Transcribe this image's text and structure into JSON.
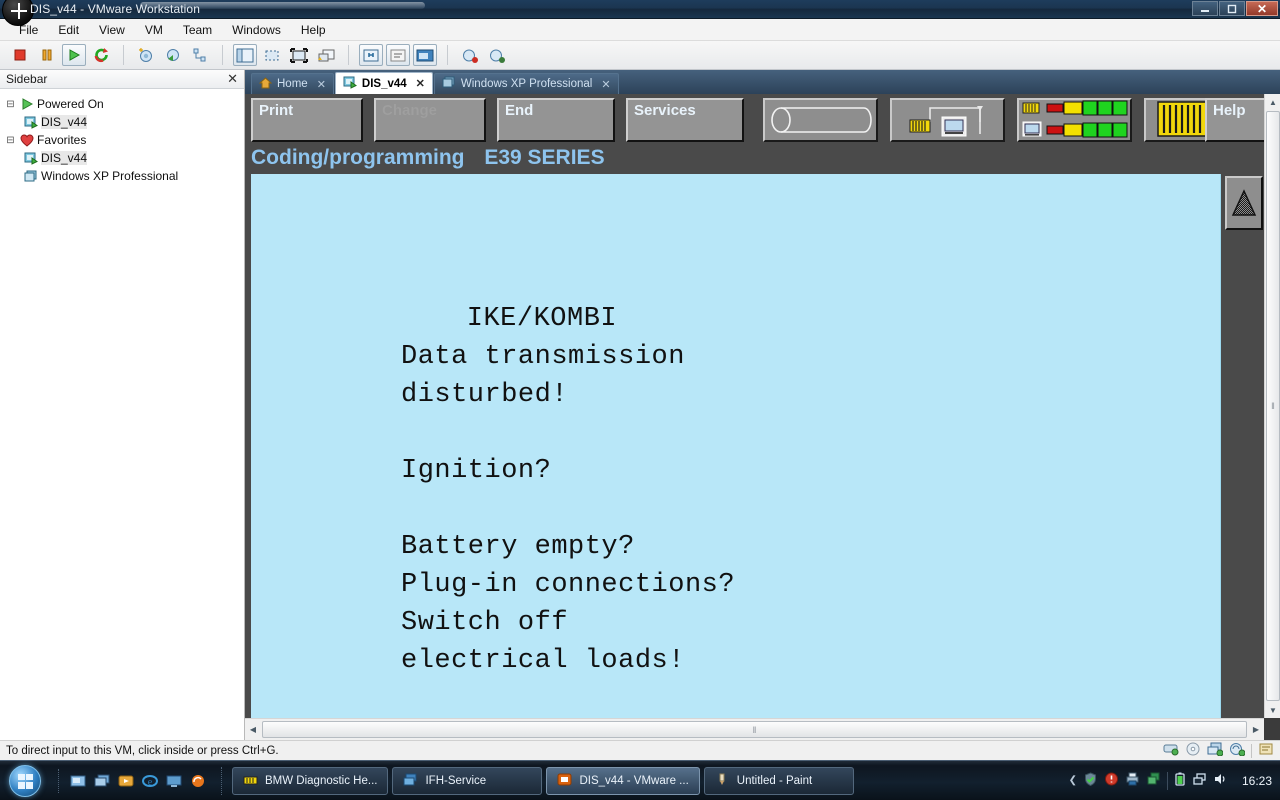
{
  "window": {
    "title": "DIS_v44 - VMware Workstation",
    "minimize_label": "—",
    "maximize_label": "❐",
    "close_label": "✕"
  },
  "menubar": {
    "items": [
      "File",
      "Edit",
      "View",
      "VM",
      "Team",
      "Windows",
      "Help"
    ]
  },
  "toolbar": {
    "buttons": [
      {
        "name": "power-off-icon",
        "title": "Power Off"
      },
      {
        "name": "suspend-icon",
        "title": "Suspend"
      },
      {
        "name": "power-on-icon",
        "title": "Power On"
      },
      {
        "name": "reset-icon",
        "title": "Reset"
      },
      {
        "name": "snapshot-icon",
        "title": "Take Snapshot"
      },
      {
        "name": "revert-snapshot-icon",
        "title": "Revert to Snapshot"
      },
      {
        "name": "snapshot-manager-icon",
        "title": "Snapshot Manager"
      },
      {
        "name": "show-sidebar-icon",
        "title": "Show or Hide the Sidebar"
      },
      {
        "name": "quick-switch-icon",
        "title": "Quick Switch"
      },
      {
        "name": "fullscreen-icon",
        "title": "Full Screen"
      },
      {
        "name": "unity-icon",
        "title": "Unity"
      },
      {
        "name": "settings-icon",
        "title": "Virtual Machine Settings"
      },
      {
        "name": "summary-icon",
        "title": "Summary"
      },
      {
        "name": "console-view-icon",
        "title": "Console View"
      },
      {
        "name": "capture-screen-icon",
        "title": "Capture Screen"
      },
      {
        "name": "capture-movie-icon",
        "title": "Capture Movie"
      }
    ]
  },
  "sidebar": {
    "header": "Sidebar",
    "close_label": "✕",
    "groups": [
      {
        "label": "Powered On",
        "icon": "play-icon",
        "toggle": "⊟",
        "items": [
          {
            "label": "DIS_v44",
            "icon": "vm-running-icon",
            "selected": true
          }
        ]
      },
      {
        "label": "Favorites",
        "icon": "heart-icon",
        "toggle": "⊟",
        "items": [
          {
            "label": "DIS_v44",
            "icon": "vm-running-icon",
            "selected": true
          },
          {
            "label": "Windows XP Professional",
            "icon": "vm-icon",
            "selected": false
          }
        ]
      }
    ]
  },
  "tabs": [
    {
      "label": "Home",
      "icon": "home-icon",
      "active": false,
      "close": "✕"
    },
    {
      "label": "DIS_v44",
      "icon": "vm-running-icon",
      "active": true,
      "close": "✕"
    },
    {
      "label": "Windows XP Professional",
      "icon": "vm-icon",
      "active": false,
      "close": "✕"
    }
  ],
  "dis": {
    "buttons": [
      {
        "label": "Print",
        "disabled": false
      },
      {
        "label": "Change",
        "disabled": true
      },
      {
        "label": "End",
        "disabled": false
      },
      {
        "label": "Services",
        "disabled": false
      }
    ],
    "icon_boxes": [
      {
        "name": "cylinder-icon"
      },
      {
        "name": "interface-connection-icon"
      },
      {
        "name": "status-leds-icon"
      },
      {
        "name": "connector-pins-icon"
      }
    ],
    "help_label": "Help",
    "title_main": "Coding/programming",
    "title_series": "E39 SERIES",
    "screen_lines": [
      "IKE/KOMBI",
      "Data transmission",
      "disturbed!",
      "",
      "Ignition?",
      "",
      "Battery empty?",
      "Plug-in connections?",
      "Switch off",
      "electrical loads!"
    ],
    "screen_heading": "IKE/KOMBI",
    "screen_body": "Data transmission\ndisturbed!\n\nIgnition?\n\nBattery empty?\nPlug-in connections?\nSwitch off\nelectrical loads!",
    "scroll_up_icon": "triangle-up-icon",
    "colors": {
      "screen_bg": "#b8e7f8",
      "chrome": "#4a4a4a",
      "title_text": "#8ec4ee",
      "button_face": "#949494",
      "led_green": "#22d422",
      "led_yellow": "#f5e400",
      "led_red": "#cc1111"
    }
  },
  "scrollbars": {
    "up_arrow": "▲",
    "down_arrow": "▼",
    "left_arrow": "◀",
    "right_arrow": "▶",
    "grip": "‖"
  },
  "statusbar": {
    "message": "To direct input to this VM, click inside or press Ctrl+G.",
    "icons": [
      {
        "name": "hard-disk-icon"
      },
      {
        "name": "cd-dvd-icon"
      },
      {
        "name": "network-adapter-icon"
      },
      {
        "name": "sound-adapter-icon"
      },
      {
        "name": "message-log-icon"
      }
    ]
  },
  "taskbar": {
    "start_label": "Start",
    "quick_launch": [
      {
        "name": "show-desktop-icon"
      },
      {
        "name": "switch-window-icon"
      },
      {
        "name": "media-player-icon"
      },
      {
        "name": "internet-explorer-icon"
      },
      {
        "name": "remote-desktop-icon"
      },
      {
        "name": "firefox-icon"
      }
    ],
    "tasks": [
      {
        "label": "BMW Diagnostic He...",
        "icon": "bmw-diagnostic-icon",
        "active": false
      },
      {
        "label": "IFH-Service",
        "icon": "ifh-service-icon",
        "active": false
      },
      {
        "label": "DIS_v44 - VMware ...",
        "icon": "vmware-icon",
        "active": true
      },
      {
        "label": "Untitled - Paint",
        "icon": "paint-icon",
        "active": false
      }
    ],
    "tray": {
      "expand": "❮",
      "icons": [
        {
          "name": "antivirus-shield-icon"
        },
        {
          "name": "security-alert-icon"
        },
        {
          "name": "printer-icon"
        },
        {
          "name": "vmware-tray-icon"
        },
        {
          "name": "battery-icon"
        },
        {
          "name": "network-icon"
        },
        {
          "name": "volume-icon"
        }
      ],
      "clock": "16:23"
    }
  }
}
